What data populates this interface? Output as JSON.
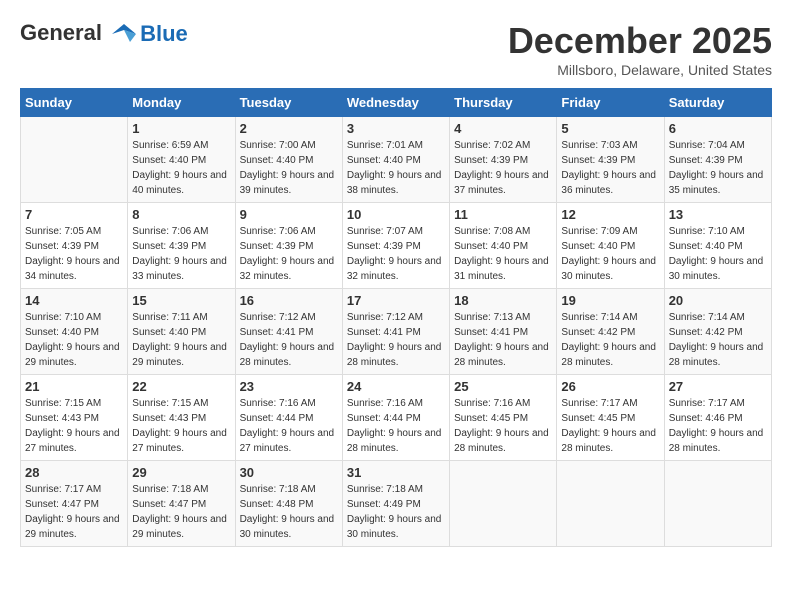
{
  "logo": {
    "line1": "General",
    "line2": "Blue"
  },
  "title": "December 2025",
  "location": "Millsboro, Delaware, United States",
  "days_header": [
    "Sunday",
    "Monday",
    "Tuesday",
    "Wednesday",
    "Thursday",
    "Friday",
    "Saturday"
  ],
  "weeks": [
    [
      {
        "num": "",
        "sunrise": "",
        "sunset": "",
        "daylight": ""
      },
      {
        "num": "1",
        "sunrise": "Sunrise: 6:59 AM",
        "sunset": "Sunset: 4:40 PM",
        "daylight": "Daylight: 9 hours and 40 minutes."
      },
      {
        "num": "2",
        "sunrise": "Sunrise: 7:00 AM",
        "sunset": "Sunset: 4:40 PM",
        "daylight": "Daylight: 9 hours and 39 minutes."
      },
      {
        "num": "3",
        "sunrise": "Sunrise: 7:01 AM",
        "sunset": "Sunset: 4:40 PM",
        "daylight": "Daylight: 9 hours and 38 minutes."
      },
      {
        "num": "4",
        "sunrise": "Sunrise: 7:02 AM",
        "sunset": "Sunset: 4:39 PM",
        "daylight": "Daylight: 9 hours and 37 minutes."
      },
      {
        "num": "5",
        "sunrise": "Sunrise: 7:03 AM",
        "sunset": "Sunset: 4:39 PM",
        "daylight": "Daylight: 9 hours and 36 minutes."
      },
      {
        "num": "6",
        "sunrise": "Sunrise: 7:04 AM",
        "sunset": "Sunset: 4:39 PM",
        "daylight": "Daylight: 9 hours and 35 minutes."
      }
    ],
    [
      {
        "num": "7",
        "sunrise": "Sunrise: 7:05 AM",
        "sunset": "Sunset: 4:39 PM",
        "daylight": "Daylight: 9 hours and 34 minutes."
      },
      {
        "num": "8",
        "sunrise": "Sunrise: 7:06 AM",
        "sunset": "Sunset: 4:39 PM",
        "daylight": "Daylight: 9 hours and 33 minutes."
      },
      {
        "num": "9",
        "sunrise": "Sunrise: 7:06 AM",
        "sunset": "Sunset: 4:39 PM",
        "daylight": "Daylight: 9 hours and 32 minutes."
      },
      {
        "num": "10",
        "sunrise": "Sunrise: 7:07 AM",
        "sunset": "Sunset: 4:39 PM",
        "daylight": "Daylight: 9 hours and 32 minutes."
      },
      {
        "num": "11",
        "sunrise": "Sunrise: 7:08 AM",
        "sunset": "Sunset: 4:40 PM",
        "daylight": "Daylight: 9 hours and 31 minutes."
      },
      {
        "num": "12",
        "sunrise": "Sunrise: 7:09 AM",
        "sunset": "Sunset: 4:40 PM",
        "daylight": "Daylight: 9 hours and 30 minutes."
      },
      {
        "num": "13",
        "sunrise": "Sunrise: 7:10 AM",
        "sunset": "Sunset: 4:40 PM",
        "daylight": "Daylight: 9 hours and 30 minutes."
      }
    ],
    [
      {
        "num": "14",
        "sunrise": "Sunrise: 7:10 AM",
        "sunset": "Sunset: 4:40 PM",
        "daylight": "Daylight: 9 hours and 29 minutes."
      },
      {
        "num": "15",
        "sunrise": "Sunrise: 7:11 AM",
        "sunset": "Sunset: 4:40 PM",
        "daylight": "Daylight: 9 hours and 29 minutes."
      },
      {
        "num": "16",
        "sunrise": "Sunrise: 7:12 AM",
        "sunset": "Sunset: 4:41 PM",
        "daylight": "Daylight: 9 hours and 28 minutes."
      },
      {
        "num": "17",
        "sunrise": "Sunrise: 7:12 AM",
        "sunset": "Sunset: 4:41 PM",
        "daylight": "Daylight: 9 hours and 28 minutes."
      },
      {
        "num": "18",
        "sunrise": "Sunrise: 7:13 AM",
        "sunset": "Sunset: 4:41 PM",
        "daylight": "Daylight: 9 hours and 28 minutes."
      },
      {
        "num": "19",
        "sunrise": "Sunrise: 7:14 AM",
        "sunset": "Sunset: 4:42 PM",
        "daylight": "Daylight: 9 hours and 28 minutes."
      },
      {
        "num": "20",
        "sunrise": "Sunrise: 7:14 AM",
        "sunset": "Sunset: 4:42 PM",
        "daylight": "Daylight: 9 hours and 28 minutes."
      }
    ],
    [
      {
        "num": "21",
        "sunrise": "Sunrise: 7:15 AM",
        "sunset": "Sunset: 4:43 PM",
        "daylight": "Daylight: 9 hours and 27 minutes."
      },
      {
        "num": "22",
        "sunrise": "Sunrise: 7:15 AM",
        "sunset": "Sunset: 4:43 PM",
        "daylight": "Daylight: 9 hours and 27 minutes."
      },
      {
        "num": "23",
        "sunrise": "Sunrise: 7:16 AM",
        "sunset": "Sunset: 4:44 PM",
        "daylight": "Daylight: 9 hours and 27 minutes."
      },
      {
        "num": "24",
        "sunrise": "Sunrise: 7:16 AM",
        "sunset": "Sunset: 4:44 PM",
        "daylight": "Daylight: 9 hours and 28 minutes."
      },
      {
        "num": "25",
        "sunrise": "Sunrise: 7:16 AM",
        "sunset": "Sunset: 4:45 PM",
        "daylight": "Daylight: 9 hours and 28 minutes."
      },
      {
        "num": "26",
        "sunrise": "Sunrise: 7:17 AM",
        "sunset": "Sunset: 4:45 PM",
        "daylight": "Daylight: 9 hours and 28 minutes."
      },
      {
        "num": "27",
        "sunrise": "Sunrise: 7:17 AM",
        "sunset": "Sunset: 4:46 PM",
        "daylight": "Daylight: 9 hours and 28 minutes."
      }
    ],
    [
      {
        "num": "28",
        "sunrise": "Sunrise: 7:17 AM",
        "sunset": "Sunset: 4:47 PM",
        "daylight": "Daylight: 9 hours and 29 minutes."
      },
      {
        "num": "29",
        "sunrise": "Sunrise: 7:18 AM",
        "sunset": "Sunset: 4:47 PM",
        "daylight": "Daylight: 9 hours and 29 minutes."
      },
      {
        "num": "30",
        "sunrise": "Sunrise: 7:18 AM",
        "sunset": "Sunset: 4:48 PM",
        "daylight": "Daylight: 9 hours and 30 minutes."
      },
      {
        "num": "31",
        "sunrise": "Sunrise: 7:18 AM",
        "sunset": "Sunset: 4:49 PM",
        "daylight": "Daylight: 9 hours and 30 minutes."
      },
      {
        "num": "",
        "sunrise": "",
        "sunset": "",
        "daylight": ""
      },
      {
        "num": "",
        "sunrise": "",
        "sunset": "",
        "daylight": ""
      },
      {
        "num": "",
        "sunrise": "",
        "sunset": "",
        "daylight": ""
      }
    ]
  ]
}
